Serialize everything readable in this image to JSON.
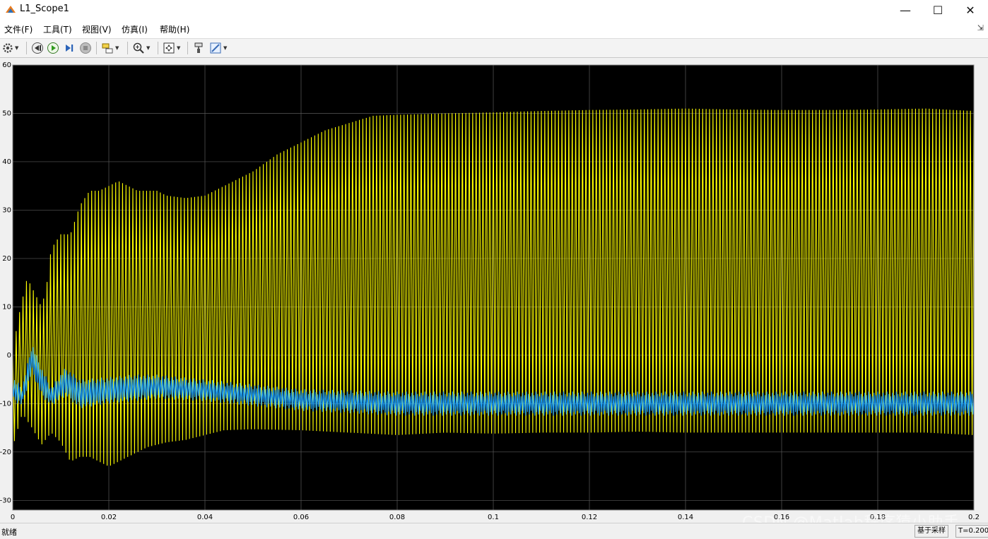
{
  "window": {
    "title": "L1_Scope1",
    "minimize": "—",
    "maximize": "☐",
    "close": "✕"
  },
  "menu": {
    "items": [
      "文件(F)",
      "工具(T)",
      "视图(V)",
      "仿真(I)",
      "帮助(H)"
    ],
    "pin": "⇲"
  },
  "toolbar": {
    "icons": [
      "gear-icon",
      "step-back-icon",
      "run-icon",
      "step-forward-icon",
      "stop-icon",
      "highlight-block-icon",
      "zoom-icon",
      "fit-to-view-icon",
      "style-icon",
      "measure-icon"
    ]
  },
  "status": {
    "text": "就绪",
    "mode": "基于采样",
    "time": "T=0.200"
  },
  "watermark": "CSDN @Matlab程序猿小助手",
  "colors": {
    "plot_bg": "#000000",
    "grid": "#5a5a5a",
    "series1": "#ffff00",
    "series2": "#1a9fff"
  },
  "chart_data": {
    "type": "line",
    "xlim": [
      0,
      0.2
    ],
    "ylim": [
      -32,
      60
    ],
    "xticks": [
      0,
      0.02,
      0.04,
      0.06,
      0.08,
      0.1,
      0.12,
      0.14,
      0.16,
      0.18,
      0.2
    ],
    "xtick_labels": [
      "0",
      "0.02",
      "0.04",
      "0.06",
      "0.08",
      "0.1",
      "0.12",
      "0.14",
      "0.16",
      "0.18",
      "0.2"
    ],
    "yticks": [
      -30,
      -20,
      -10,
      0,
      10,
      20,
      30,
      40,
      50,
      60
    ],
    "ytick_labels": [
      "-30",
      "-20",
      "-10",
      "0",
      "10",
      "20",
      "30",
      "40",
      "50",
      "60"
    ],
    "grid": true,
    "series": [
      {
        "color": "#ffff00",
        "kind": "envelope-oscillation",
        "upper": [
          [
            0,
            0
          ],
          [
            0.001,
            7
          ],
          [
            0.003,
            16
          ],
          [
            0.004,
            14
          ],
          [
            0.006,
            10
          ],
          [
            0.007,
            14
          ],
          [
            0.008,
            22
          ],
          [
            0.01,
            25
          ],
          [
            0.012,
            25
          ],
          [
            0.014,
            31
          ],
          [
            0.016,
            34
          ],
          [
            0.018,
            34
          ],
          [
            0.02,
            35
          ],
          [
            0.022,
            36
          ],
          [
            0.026,
            34
          ],
          [
            0.03,
            34
          ],
          [
            0.032,
            33
          ],
          [
            0.036,
            32.5
          ],
          [
            0.04,
            33
          ],
          [
            0.044,
            35
          ],
          [
            0.05,
            38
          ],
          [
            0.055,
            41.5
          ],
          [
            0.06,
            44
          ],
          [
            0.065,
            46.5
          ],
          [
            0.07,
            48
          ],
          [
            0.075,
            49.5
          ],
          [
            0.08,
            49.7
          ],
          [
            0.09,
            50
          ],
          [
            0.1,
            50.2
          ],
          [
            0.11,
            50.5
          ],
          [
            0.12,
            50.7
          ],
          [
            0.13,
            50.8
          ],
          [
            0.14,
            51
          ],
          [
            0.15,
            50.8
          ],
          [
            0.16,
            50.7
          ],
          [
            0.17,
            50.7
          ],
          [
            0.18,
            50.8
          ],
          [
            0.19,
            51
          ],
          [
            0.2,
            50.5
          ]
        ],
        "lower": [
          [
            0,
            -19
          ],
          [
            0.002,
            -12
          ],
          [
            0.004,
            -15
          ],
          [
            0.006,
            -18.5
          ],
          [
            0.008,
            -16
          ],
          [
            0.01,
            -18
          ],
          [
            0.012,
            -22
          ],
          [
            0.014,
            -21
          ],
          [
            0.016,
            -21
          ],
          [
            0.02,
            -23
          ],
          [
            0.024,
            -21
          ],
          [
            0.028,
            -19
          ],
          [
            0.032,
            -18
          ],
          [
            0.036,
            -17.5
          ],
          [
            0.04,
            -16.5
          ],
          [
            0.044,
            -15.5
          ],
          [
            0.05,
            -15.3
          ],
          [
            0.06,
            -15.5
          ],
          [
            0.07,
            -16
          ],
          [
            0.08,
            -16.5
          ],
          [
            0.09,
            -16
          ],
          [
            0.1,
            -16.2
          ],
          [
            0.11,
            -16
          ],
          [
            0.12,
            -16
          ],
          [
            0.13,
            -15.8
          ],
          [
            0.14,
            -16
          ],
          [
            0.15,
            -16
          ],
          [
            0.16,
            -16
          ],
          [
            0.17,
            -16
          ],
          [
            0.18,
            -16
          ],
          [
            0.19,
            -16
          ],
          [
            0.2,
            -16.5
          ]
        ]
      },
      {
        "color": "#1a9fff",
        "kind": "envelope-oscillation",
        "upper": [
          [
            0,
            -5
          ],
          [
            0.002,
            -7
          ],
          [
            0.004,
            2
          ],
          [
            0.006,
            -3
          ],
          [
            0.008,
            -7
          ],
          [
            0.011,
            -3
          ],
          [
            0.014,
            -5.5
          ],
          [
            0.02,
            -5
          ],
          [
            0.025,
            -4.5
          ],
          [
            0.03,
            -4.5
          ],
          [
            0.04,
            -5.5
          ],
          [
            0.05,
            -6.5
          ],
          [
            0.06,
            -7.5
          ],
          [
            0.08,
            -8
          ],
          [
            0.1,
            -8
          ],
          [
            0.12,
            -8
          ],
          [
            0.14,
            -8
          ],
          [
            0.16,
            -8
          ],
          [
            0.18,
            -8
          ],
          [
            0.2,
            -8
          ]
        ],
        "lower": [
          [
            0,
            -9
          ],
          [
            0.002,
            -10
          ],
          [
            0.004,
            -3
          ],
          [
            0.006,
            -8
          ],
          [
            0.008,
            -10
          ],
          [
            0.011,
            -8
          ],
          [
            0.014,
            -10.5
          ],
          [
            0.02,
            -9.5
          ],
          [
            0.025,
            -9
          ],
          [
            0.03,
            -8.5
          ],
          [
            0.04,
            -9
          ],
          [
            0.05,
            -10
          ],
          [
            0.06,
            -11
          ],
          [
            0.08,
            -12
          ],
          [
            0.1,
            -12
          ],
          [
            0.12,
            -12
          ],
          [
            0.14,
            -12
          ],
          [
            0.16,
            -12
          ],
          [
            0.18,
            -12
          ],
          [
            0.2,
            -12
          ]
        ]
      }
    ]
  }
}
